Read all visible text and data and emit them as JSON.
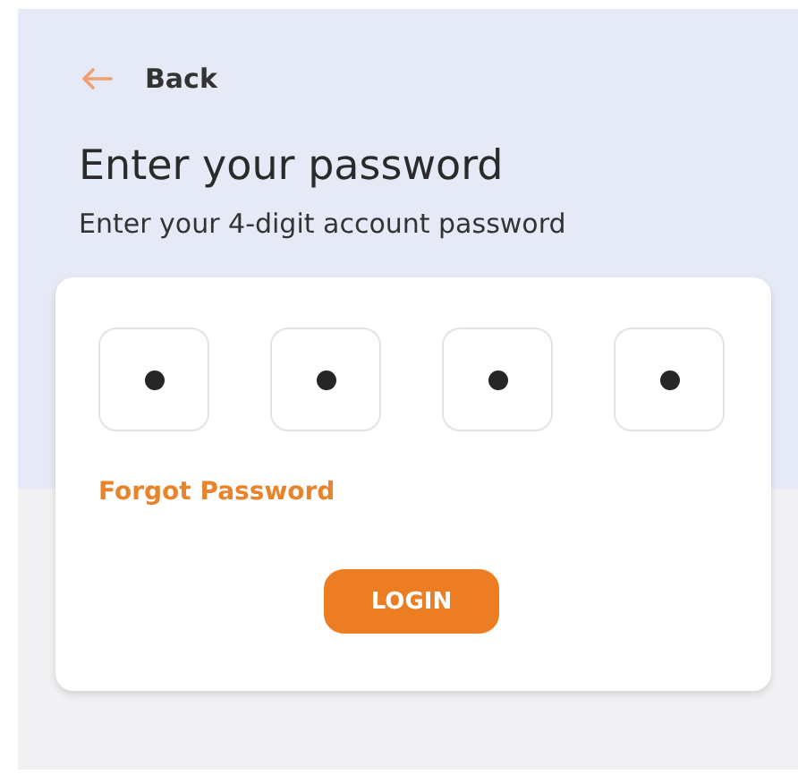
{
  "back": {
    "label": "Back"
  },
  "title": "Enter your password",
  "subtitle": "Enter your 4-digit account password",
  "pin_boxes": [
    {
      "filled": true
    },
    {
      "filled": true
    },
    {
      "filled": true
    },
    {
      "filled": true
    }
  ],
  "forgot_link": "Forgot Password",
  "login_button": "LOGIN"
}
